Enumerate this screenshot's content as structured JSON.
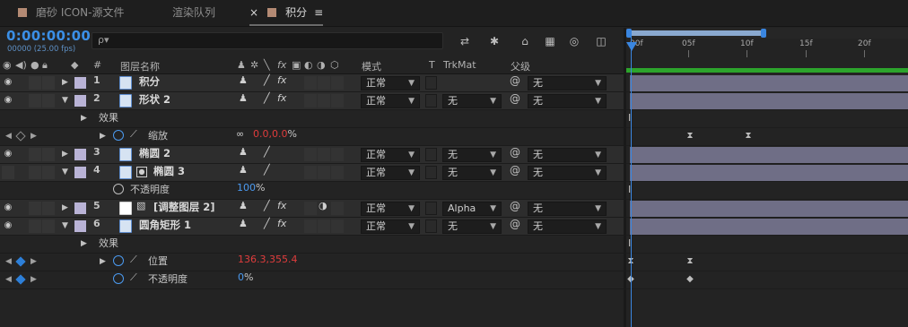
{
  "tabs": [
    {
      "label": "磨砂 ICON-源文件",
      "color": "#b48a74"
    },
    {
      "label": "渲染队列",
      "color": ""
    },
    {
      "label": "积分",
      "color": "#b48a74",
      "close": "×",
      "menu": "≡"
    }
  ],
  "header": {
    "timecode": "0:00:00:00",
    "fps": "00000 (25.00 fps)",
    "search_placeholder": "",
    "search_icon": "ρ▾"
  },
  "columns": {
    "hash": "#",
    "layer_name": "图层名称",
    "mode": "模式",
    "t": "T",
    "trkmat": "TrkMat",
    "parent": "父级"
  },
  "layers": [
    {
      "num": "1",
      "name": "积分",
      "mode": "正常",
      "trkmat": "",
      "parent": "无",
      "expanded": false,
      "fx": true,
      "type": "shape"
    },
    {
      "num": "2",
      "name": "形状 2",
      "mode": "正常",
      "trkmat": "无",
      "parent": "无",
      "expanded": true,
      "fx": true,
      "type": "shape"
    },
    {
      "num": "3",
      "name": "椭圆 2",
      "mode": "正常",
      "trkmat": "无",
      "parent": "无",
      "expanded": false,
      "fx": false,
      "type": "shape"
    },
    {
      "num": "4",
      "name": "椭圆 3",
      "mode": "正常",
      "trkmat": "无",
      "parent": "无",
      "expanded": true,
      "fx": false,
      "type": "shape"
    },
    {
      "num": "5",
      "name": "[调整图层 2]",
      "mode": "正常",
      "trkmat": "Alpha",
      "parent": "无",
      "expanded": false,
      "fx": true,
      "type": "adjustment"
    },
    {
      "num": "6",
      "name": "圆角矩形 1",
      "mode": "正常",
      "trkmat": "无",
      "parent": "无",
      "expanded": true,
      "fx": true,
      "type": "shape"
    }
  ],
  "props": {
    "effects_label": "效果",
    "scale_label": "缩放",
    "scale_value": "0.0,0.0",
    "scale_unit": "%",
    "opacity_label": "不透明度",
    "opacity_value_4": "100",
    "opacity_unit": "%",
    "position_label": "位置",
    "position_value": "136.3,355.4",
    "opacity_value_6": "0"
  },
  "ruler": {
    "labels": [
      "00f",
      "05f",
      "10f",
      "15f",
      "20f"
    ]
  },
  "colors": {
    "timecode": "#3b8fe6",
    "layer_color": "#b9b3d6",
    "bar": "#6f6e86",
    "playhead": "#3a86e0",
    "work_area": "#2ca42c",
    "value_red": "#e03c3c",
    "value_blue": "#4b9af0"
  }
}
